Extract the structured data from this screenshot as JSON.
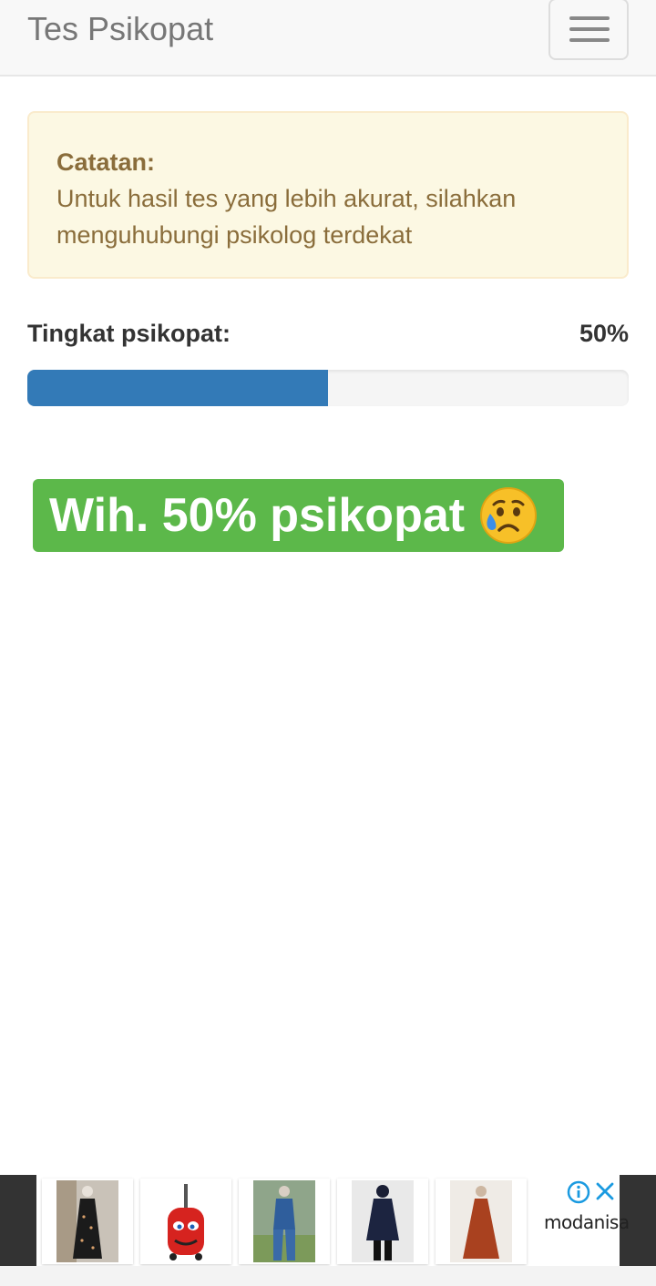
{
  "navbar": {
    "brand": "Tes Psikopat",
    "menu_icon": "hamburger-icon"
  },
  "alert": {
    "title": "Catatan:",
    "message": "Untuk hasil tes yang lebih akurat, silahkan menguhubungi psikolog terdekat"
  },
  "progress": {
    "label": "Tingkat psikopat:",
    "value_text": "50%",
    "value": 50
  },
  "result": {
    "text": "Wih. 50% psikopat",
    "emoji": "sad-sweat-emoji"
  },
  "ad": {
    "brand": "modanisa",
    "products": [
      "floral-dress",
      "kids-trolley-bag",
      "denim-set",
      "navy-tunic",
      "rust-dress"
    ],
    "info_icon": "info-icon",
    "close_icon": "close-icon"
  },
  "colors": {
    "progress_fill": "#337ab7",
    "banner_green": "#5cb84a",
    "alert_bg": "#fcf8e3",
    "alert_text": "#8a6d3b"
  }
}
